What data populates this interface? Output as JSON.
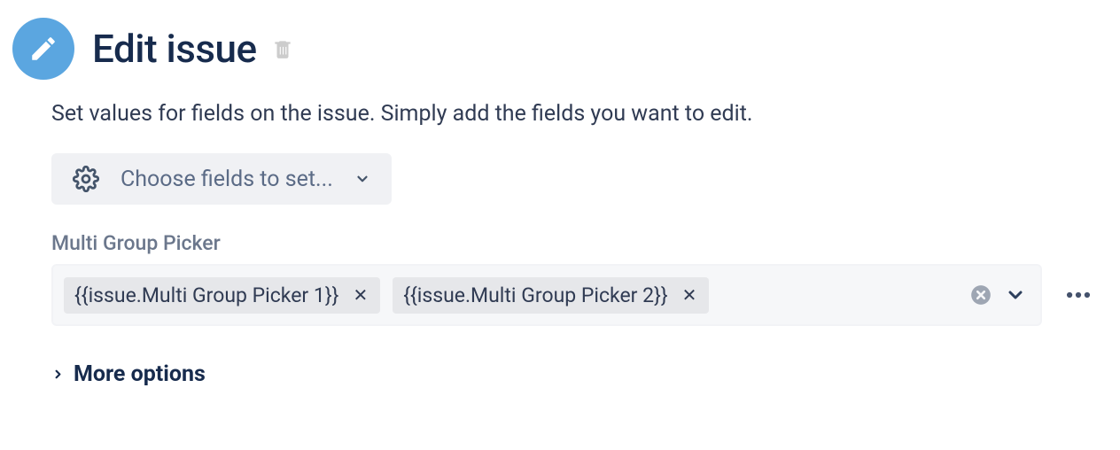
{
  "header": {
    "title": "Edit issue"
  },
  "description": "Set values for fields on the issue. Simply add the fields you want to edit.",
  "choose_fields": {
    "label": "Choose fields to set..."
  },
  "field": {
    "label": "Multi Group Picker",
    "tags": [
      "{{issue.Multi Group Picker 1}}",
      "{{issue.Multi Group Picker 2}}"
    ]
  },
  "more_options": {
    "label": "More options"
  }
}
